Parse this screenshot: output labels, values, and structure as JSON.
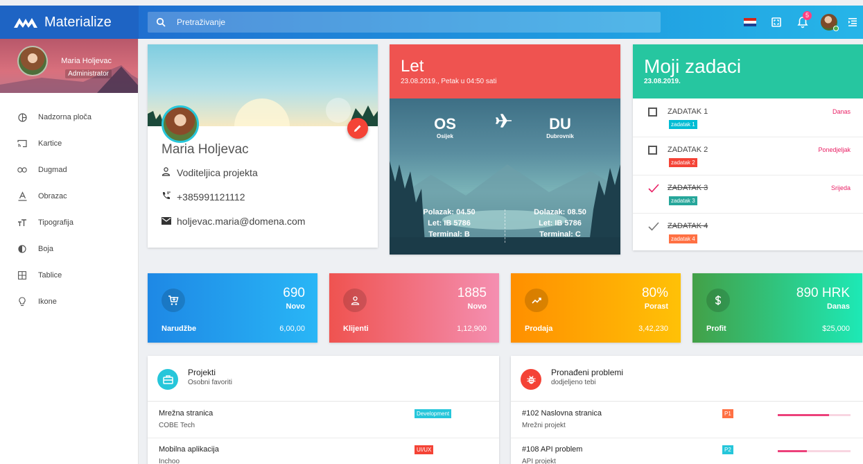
{
  "app": {
    "brand": "Materialize"
  },
  "search": {
    "placeholder": "Pretraživanje"
  },
  "header": {
    "notifications_count": "5"
  },
  "user": {
    "name": "Maria Holjevac",
    "role": "Administrator"
  },
  "sidebar": {
    "items": [
      {
        "label": "Nadzorna ploča",
        "icon": "dashboard-icon"
      },
      {
        "label": "Kartice",
        "icon": "cast-icon"
      },
      {
        "label": "Dugmad",
        "icon": "link-icon"
      },
      {
        "label": "Obrazac",
        "icon": "text-format-icon"
      },
      {
        "label": "Tipografija",
        "icon": "text-size-icon"
      },
      {
        "label": "Boja",
        "icon": "contrast-icon"
      },
      {
        "label": "Tablice",
        "icon": "grid-icon"
      },
      {
        "label": "Ikone",
        "icon": "lightbulb-icon"
      }
    ]
  },
  "profile": {
    "name": "Maria Holjevac",
    "job": "Voditeljica projekta",
    "phone": "+385991121112",
    "email": "holjevac.maria@domena.com"
  },
  "flight": {
    "title": "Let",
    "subtitle": "23.08.2019., Petak u 04:50 sati",
    "from_code": "OS",
    "from_city": "Osijek",
    "to_code": "DU",
    "to_city": "Dubrovnik",
    "departure": "Polazak: 04.50",
    "departure_flight": "Let: IB 5786",
    "departure_terminal": "Terminal: B",
    "arrival": "Dolazak: 08.50",
    "arrival_flight": "Let: IB 5786",
    "arrival_terminal": "Terminal: C"
  },
  "tasks": {
    "title": "Moji zadaci",
    "date": "23.08.2019.",
    "items": [
      {
        "title": "ZADATAK 1",
        "tag": "zadatak 1",
        "tag_color": "#00bcd4",
        "due": "Danas",
        "done": false
      },
      {
        "title": "ZADATAK 2",
        "tag": "zadatak 2",
        "tag_color": "#f44336",
        "due": "Ponedjeljak",
        "done": false
      },
      {
        "title": "ZADATAK 3",
        "tag": "zadatak 3",
        "tag_color": "#26a69a",
        "due": "Srijeda",
        "done": true
      },
      {
        "title": "ZADATAK 4",
        "tag": "zadatak 4",
        "tag_color": "#ff7043",
        "due": "",
        "done": true
      }
    ]
  },
  "stats": [
    {
      "value": "690",
      "sub": "Novo",
      "label": "Narudžbe",
      "amount": "6,00,00",
      "color_from": "#1e88e5",
      "color_to": "#29b6f6",
      "icon": "cart-icon"
    },
    {
      "value": "1885",
      "sub": "Novo",
      "label": "Klijenti",
      "amount": "1,12,900",
      "color_from": "#ef5350",
      "color_to": "#f48fb1",
      "icon": "person-icon"
    },
    {
      "value": "80%",
      "sub": "Porast",
      "label": "Prodaja",
      "amount": "3,42,230",
      "color_from": "#ff8f00",
      "color_to": "#ffc107",
      "icon": "trending-up-icon"
    },
    {
      "value": "890 HRK",
      "sub": "Danas",
      "label": "Profit",
      "amount": "$25,000",
      "color_from": "#43a047",
      "color_to": "#1de9b6",
      "icon": "dollar-icon"
    }
  ],
  "projects": {
    "title": "Projekti",
    "subtitle": "Osobni favoriti",
    "items": [
      {
        "title": "Mrežna stranica",
        "sub": "COBE Tech",
        "tag": "Development",
        "tag_color": "#26c6da"
      },
      {
        "title": "Mobilna aplikacija",
        "sub": "Inchoo",
        "tag": "UI/UX",
        "tag_color": "#f44336"
      }
    ]
  },
  "issues": {
    "title": "Pronađeni problemi",
    "subtitle": "dodjeljeno tebi",
    "items": [
      {
        "title": "#102 Naslovna stranica",
        "sub": "Mrežni projekt",
        "tag": "P1",
        "tag_color": "#ff7043",
        "progress": 0.7
      },
      {
        "title": "#108 API problem",
        "sub": "API projekt",
        "tag": "P2",
        "tag_color": "#26c6da",
        "progress": 0.4
      }
    ]
  }
}
